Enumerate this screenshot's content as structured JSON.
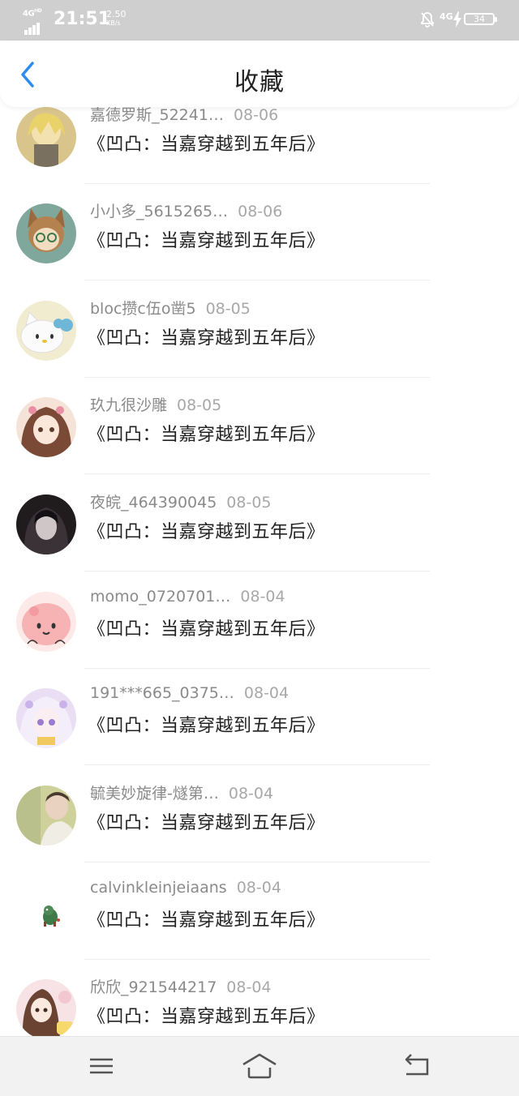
{
  "status_bar": {
    "network": "4G",
    "network_sup": "HD",
    "time": "21:51",
    "speed_value": "2.50",
    "speed_unit": "KB/s",
    "network_right": "4G",
    "battery": "34"
  },
  "header": {
    "title": "收藏",
    "back_icon": "chevron-left-icon",
    "accent_color": "#2d8cf0"
  },
  "favorites": [
    {
      "user": "嘉德罗斯_52241…",
      "date": "08-06",
      "title": "《凹凸：当嘉穿越到五年后》",
      "avatar_color": "#c9b98a"
    },
    {
      "user": "小小多_5615265…",
      "date": "08-06",
      "title": "《凹凸：当嘉穿越到五年后》",
      "avatar_color": "#6f9a8f"
    },
    {
      "user": "bloc攒c伍o凿5",
      "date": "08-05",
      "title": "《凹凸：当嘉穿越到五年后》",
      "avatar_color": "#f4f0d2"
    },
    {
      "user": "玖九很沙雕",
      "date": "08-05",
      "title": "《凹凸：当嘉穿越到五年后》",
      "avatar_color": "#d8a99a"
    },
    {
      "user": "夜皖_464390045",
      "date": "08-05",
      "title": "《凹凸：当嘉穿越到五年后》",
      "avatar_color": "#2a2628"
    },
    {
      "user": "momo_0720701…",
      "date": "08-04",
      "title": "《凹凸：当嘉穿越到五年后》",
      "avatar_color": "#f5b8b8"
    },
    {
      "user": "191***665_0375…",
      "date": "08-04",
      "title": "《凹凸：当嘉穿越到五年后》",
      "avatar_color": "#e4d8f0"
    },
    {
      "user": "毓美妙旋律-燧第…",
      "date": "08-04",
      "title": "《凹凸：当嘉穿越到五年后》",
      "avatar_color": "#d7d6a8"
    },
    {
      "user": "calvinkleinjeiaans",
      "date": "08-04",
      "title": "《凹凸：当嘉穿越到五年后》",
      "avatar_color": "#ffffff"
    },
    {
      "user": "欣欣_921544217",
      "date": "08-04",
      "title": "《凹凸：当嘉穿越到五年后》",
      "avatar_color": "#f3d6da"
    }
  ],
  "nav_bar": {
    "menu_icon": "menu-icon",
    "home_icon": "home-icon",
    "back_icon": "return-icon"
  }
}
